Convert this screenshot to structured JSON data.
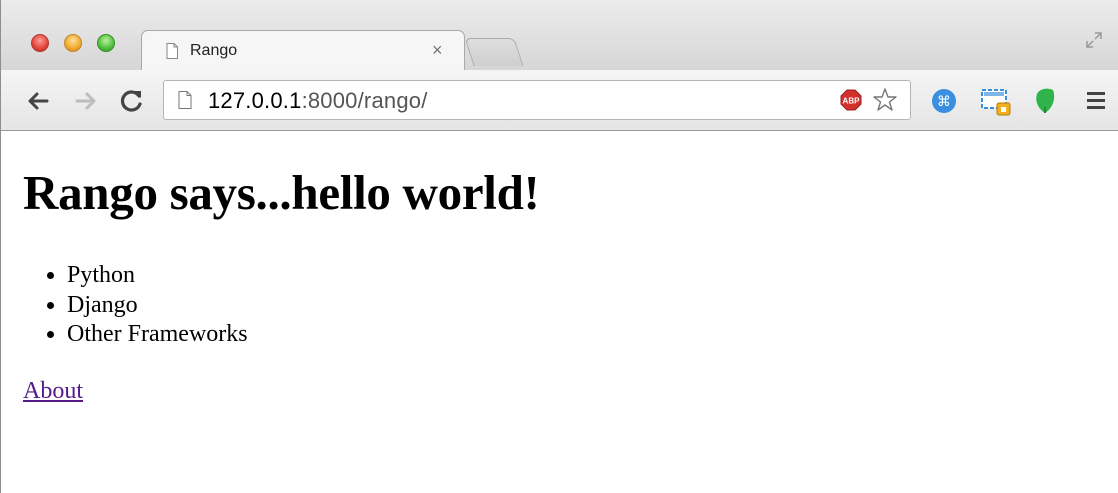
{
  "browser": {
    "tab": {
      "title": "Rango",
      "close_glyph": "×"
    },
    "address_bar": {
      "host": "127.0.0.1",
      "rest": ":8000/rango/"
    },
    "icons": {
      "back": "arrow-left-icon",
      "forward": "arrow-right-icon",
      "reload": "reload-icon",
      "page": "page-icon",
      "adblock": "adblock-plus-icon",
      "bookmark": "star-icon",
      "extension_1": "command-key-icon",
      "extension_2": "screen-capture-icon",
      "extension_3": "evernote-leaf-icon",
      "menu": "hamburger-menu-icon",
      "fullscreen": "fullscreen-icon"
    },
    "colors": {
      "adblock": "#d0312d",
      "command": "#3a8fe0",
      "leaf": "#2fb34a",
      "visited_link": "#551a8b"
    }
  },
  "page": {
    "heading": "Rango says...hello world!",
    "list": [
      "Python",
      "Django",
      "Other Frameworks"
    ],
    "link": "About"
  }
}
